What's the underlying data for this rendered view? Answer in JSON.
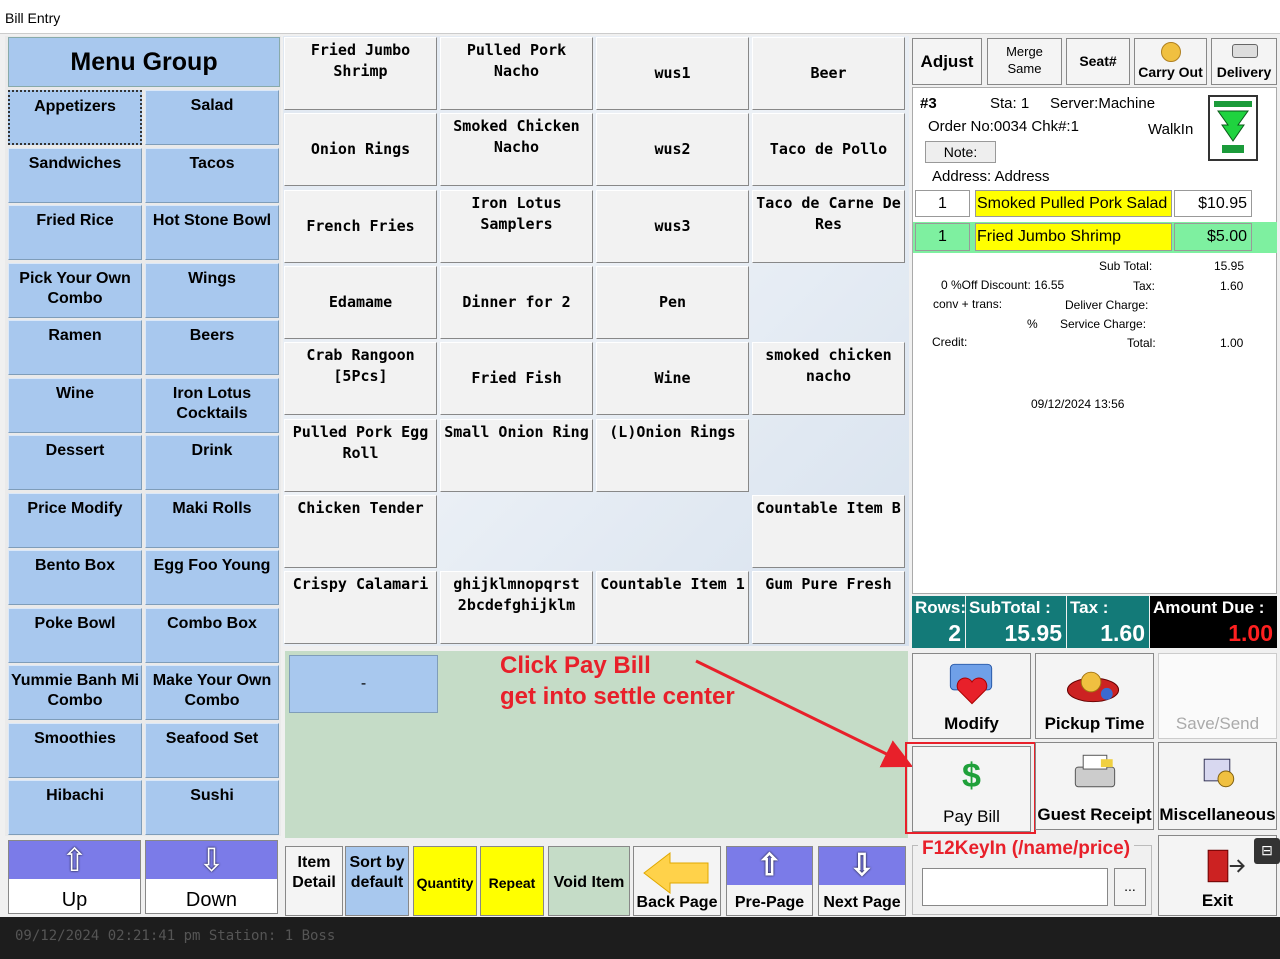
{
  "window": {
    "title": "Bill Entry"
  },
  "menu_group": {
    "title": "Menu Group",
    "items": [
      "Appetizers",
      "Salad",
      "Sandwiches",
      "Tacos",
      "Fried Rice",
      "Hot Stone Bowl",
      "Pick Your Own Combo",
      "Wings",
      "Ramen",
      "Beers",
      "Wine",
      "Iron Lotus Cocktails",
      "Dessert",
      "Drink",
      "Price Modify",
      "Maki Rolls",
      "Bento Box",
      "Egg Foo Young",
      "Poke Bowl",
      "Combo Box",
      "Yummie Banh Mi Combo",
      "Make Your Own Combo",
      "Smoothies",
      "Seafood Set",
      "Hibachi",
      "Sushi"
    ]
  },
  "items": [
    "Fried Jumbo Shrimp",
    "Pulled Pork Nacho",
    "wus1",
    "Beer",
    "Onion Rings",
    "Smoked Chicken Nacho",
    "wus2",
    "Taco de Pollo",
    "French Fries",
    "Iron Lotus Samplers",
    "wus3",
    "Taco de Carne De Res",
    "Edamame",
    "Dinner for 2",
    "Pen",
    "",
    "Crab Rangoon [5Pcs]",
    "Fried Fish",
    "Wine",
    "smoked chicken nacho",
    "Pulled Pork Egg Roll",
    "Small Onion Ring",
    "(L)Onion Rings",
    "",
    "Chicken Tender",
    "",
    "",
    "Countable Item B",
    "Crispy Calamari",
    "ghijklmnopqrst 2bcdefghijklm",
    "Countable Item 1",
    "Gum Pure Fresh"
  ],
  "order_area": {
    "dash_label": "-"
  },
  "annotation": {
    "line1": "Click Pay Bill",
    "line2": "get into settle center"
  },
  "nav": {
    "up_label": "Up",
    "down_label": "Down"
  },
  "toolbar": {
    "item_detail": "Item Detail",
    "sort_default": "Sort by default",
    "quantity": "Quantity",
    "repeat": "Repeat",
    "void_item": "Void Item",
    "back_page": "Back Page",
    "pre_page": "Pre-Page",
    "next_page": "Next Page"
  },
  "header_buttons": {
    "adjust": "Adjust",
    "merge_same": "Merge Same",
    "seat": "Seat#",
    "carry_out": "Carry Out",
    "delivery": "Delivery"
  },
  "receipt": {
    "order_num": "#3",
    "station": "Sta: 1",
    "server": "Server:Machine",
    "order_no": "Order No:0034 Chk#:1",
    "order_type": "WalkIn",
    "note_label": "Note:",
    "address": "Address: Address",
    "lines": [
      {
        "qty": "1",
        "name": "Smoked Pulled Pork Salad",
        "price": "$10.95"
      },
      {
        "qty": "1",
        "name": "Fried Jumbo Shrimp",
        "price": "$5.00"
      }
    ],
    "sub_total_label": "Sub Total:",
    "sub_total": "15.95",
    "discount_text": "0 %Off  Discount: 16.55",
    "tax_label": "Tax:",
    "tax": "1.60",
    "conv_label": "conv + trans:",
    "deliver_label": "Deliver Charge:",
    "pct_label": "%",
    "service_label": "Service Charge:",
    "credit_label": "Credit:",
    "total_label": "Total:",
    "total": "1.00",
    "datetime": "09/12/2024 13:56"
  },
  "totals": {
    "rows_label": "Rows:",
    "rows": "2",
    "subtotal_label": "SubTotal :",
    "subtotal": "15.95",
    "tax_label": "Tax :",
    "tax": "1.60",
    "amount_due_label": "Amount Due :",
    "amount_due": "1.00"
  },
  "actions": {
    "modify": "Modify",
    "pickup_time": "Pickup Time",
    "save_send": "Save/Send",
    "pay_bill": "Pay Bill",
    "guest_receipt": "Guest Receipt",
    "miscellaneous": "Miscellaneous",
    "exit": "Exit"
  },
  "keyin": {
    "label": "F12KeyIn (/name/price)",
    "browse": "..."
  },
  "status": {
    "text": "09/12/2024 02:21:41 pm  Station: 1     Boss"
  },
  "colors": {
    "menu_group_bg": "#a8c8ee",
    "highlight_yellow": "#ffff00",
    "selected_line_green": "#7ef0a0",
    "totals_teal": "#137a78",
    "amount_due_red": "#ff2020",
    "annotation_red": "#e8202a"
  }
}
